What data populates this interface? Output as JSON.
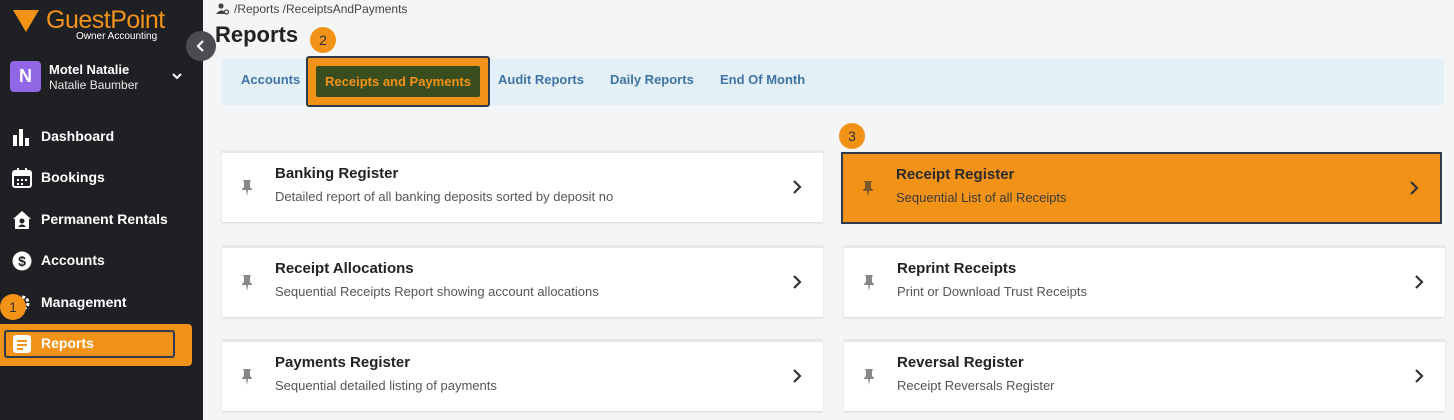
{
  "sidebar": {
    "brand": "GuestPoint",
    "brand_sub": "Owner Accounting",
    "property": {
      "avatar": "N",
      "name": "Motel Natalie",
      "user": "Natalie Baumber"
    },
    "items": [
      {
        "label": "Dashboard",
        "icon": "bar-chart-icon"
      },
      {
        "label": "Bookings",
        "icon": "calendar-icon"
      },
      {
        "label": "Permanent Rentals",
        "icon": "house-icon"
      },
      {
        "label": "Accounts",
        "icon": "dollar-icon"
      },
      {
        "label": "Management",
        "icon": "gear-icon"
      },
      {
        "label": "Reports",
        "icon": "report-icon"
      }
    ],
    "active_item": "Reports"
  },
  "steps": [
    "1",
    "2",
    "3"
  ],
  "breadcrumb": "/Reports /ReceiptsAndPayments",
  "page_title": "Reports",
  "tabs": [
    {
      "label": "Accounts"
    },
    {
      "label": "Receipts and Payments"
    },
    {
      "label": "Audit Reports"
    },
    {
      "label": "Daily Reports"
    },
    {
      "label": "End Of Month"
    }
  ],
  "cards": [
    {
      "title": "Banking Register",
      "desc": "Detailed report of all banking deposits sorted by deposit no"
    },
    {
      "title": "Receipt Register",
      "desc": "Sequential List of all Receipts"
    },
    {
      "title": "Receipt Allocations",
      "desc": "Sequential Receipts Report showing account allocations"
    },
    {
      "title": "Reprint Receipts",
      "desc": "Print or Download Trust Receipts"
    },
    {
      "title": "Payments Register",
      "desc": "Sequential detailed listing of payments"
    },
    {
      "title": "Reversal Register",
      "desc": "Receipt Reversals Register"
    }
  ],
  "colors": {
    "accent": "#f29318",
    "sidebar_bg": "#1f2023",
    "tab_text": "#3f74a8",
    "tab_active_bg": "#3a4d1f",
    "outline": "#2d3b4a"
  }
}
